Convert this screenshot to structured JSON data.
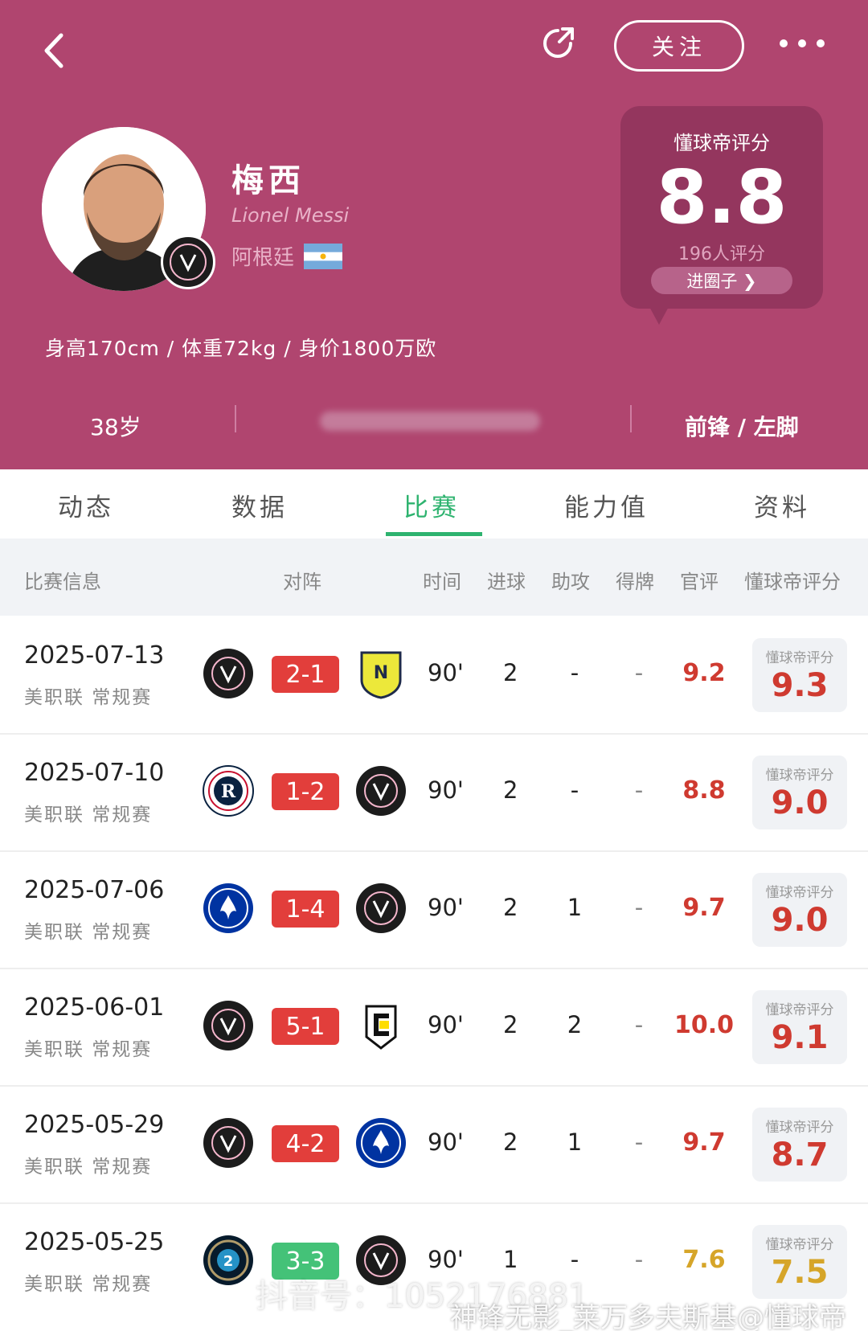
{
  "header": {
    "follow_label": "关注",
    "player": {
      "name_cn": "梅西",
      "name_en": "Lionel Messi",
      "nation": "阿根廷",
      "body_stats": "身高170cm / 体重72kg / 身价1800万欧",
      "age": "38岁",
      "position": "前锋 / 左脚"
    },
    "rating": {
      "title": "懂球帝评分",
      "value": "8.8",
      "count": "196人评分",
      "circle_button": "进圈子 ❯"
    }
  },
  "tabs": [
    "动态",
    "数据",
    "比赛",
    "能力值",
    "资料"
  ],
  "active_tab": "比赛",
  "columns": [
    "比赛信息",
    "对阵",
    "时间",
    "进球",
    "助攻",
    "得牌",
    "官评",
    "懂球帝评分"
  ],
  "rate_card_label": "懂球帝评分",
  "matches": [
    {
      "date": "2025-07-13",
      "league": "美职联 常规赛",
      "home": "Inter Miami",
      "away": "Nashville SC",
      "score": "2-1",
      "result": "win",
      "minutes": "90'",
      "goals": "2",
      "assists": "-",
      "cards": "-",
      "official": "9.2",
      "rating": "9.3"
    },
    {
      "date": "2025-07-10",
      "league": "美职联 常规赛",
      "home": "New England Revolution",
      "away": "Inter Miami",
      "score": "1-2",
      "result": "win",
      "minutes": "90'",
      "goals": "2",
      "assists": "-",
      "cards": "-",
      "official": "8.8",
      "rating": "9.0"
    },
    {
      "date": "2025-07-06",
      "league": "美职联 常规赛",
      "home": "CF Montreal",
      "away": "Inter Miami",
      "score": "1-4",
      "result": "win",
      "minutes": "90'",
      "goals": "2",
      "assists": "1",
      "cards": "-",
      "official": "9.7",
      "rating": "9.0"
    },
    {
      "date": "2025-06-01",
      "league": "美职联 常规赛",
      "home": "Inter Miami",
      "away": "Columbus Crew",
      "score": "5-1",
      "result": "win",
      "minutes": "90'",
      "goals": "2",
      "assists": "2",
      "cards": "-",
      "official": "10.0",
      "rating": "9.1"
    },
    {
      "date": "2025-05-29",
      "league": "美职联 常规赛",
      "home": "Inter Miami",
      "away": "CF Montreal",
      "score": "4-2",
      "result": "win",
      "minutes": "90'",
      "goals": "2",
      "assists": "1",
      "cards": "-",
      "official": "9.7",
      "rating": "8.7"
    },
    {
      "date": "2025-05-25",
      "league": "美职联 常规赛",
      "home": "Philadelphia Union",
      "away": "Inter Miami",
      "score": "3-3",
      "result": "draw",
      "minutes": "90'",
      "goals": "1",
      "assists": "-",
      "cards": "-",
      "official": "7.6",
      "rating": "7.5"
    }
  ],
  "watermarks": [
    "抖音号：1052176881",
    "神锋无影_莱万多夫斯基@懂球帝"
  ],
  "colors": {
    "header_bg": "#b0456f",
    "accent_green": "#2eb36f",
    "score_red": "#e23e3b",
    "score_green": "#44c278",
    "rating_red": "#cf3a30",
    "rating_gold": "#d6a529"
  }
}
